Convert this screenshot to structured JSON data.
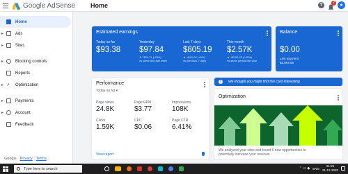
{
  "header": {
    "app_name": "Google AdSense",
    "page_title": "Home",
    "notification_count": "2"
  },
  "sidebar": {
    "items": [
      {
        "label": "Home",
        "expandable": false,
        "active": true
      },
      {
        "label": "Ads",
        "expandable": true
      },
      {
        "label": "Sites",
        "expandable": true
      },
      {
        "label": "Blocking controls",
        "expandable": true
      },
      {
        "label": "Reports",
        "expandable": false
      },
      {
        "label": "Optimization",
        "expandable": true
      },
      {
        "label": "Payments",
        "expandable": true
      },
      {
        "label": "Account",
        "expandable": true
      },
      {
        "label": "Feedback",
        "expandable": false
      }
    ],
    "footer": {
      "brand": "Google",
      "privacy": "Privacy",
      "terms": "Terms"
    }
  },
  "estimated": {
    "title": "Estimated earnings",
    "cols": [
      {
        "label": "Today so far",
        "value": "$93.38",
        "change": "",
        "sub": ""
      },
      {
        "label": "Yesterday",
        "value": "$97.84",
        "change": "▼ -$29.71 (-23%)",
        "sub": "vs same day last week"
      },
      {
        "label": "Last 7 days",
        "value": "$805.19",
        "change": "▲ +$41.02 (+5%)",
        "sub": "vs previous 7 days"
      },
      {
        "label": "This month",
        "value": "$2.57K",
        "change": "▲ +$792.33 (+45%)",
        "sub": "vs same period last year"
      }
    ]
  },
  "balance": {
    "title": "Balance",
    "value": "$0.00",
    "sub1": "Last payment",
    "sub2": "$2,894.05"
  },
  "performance": {
    "title": "Performance",
    "range": "Today so far",
    "metrics": [
      {
        "label": "Page views",
        "value": "24.8K"
      },
      {
        "label": "Page RPM",
        "value": "$3.77"
      },
      {
        "label": "Impressions",
        "value": "108K"
      },
      {
        "label": "Clicks",
        "value": "1.59K"
      },
      {
        "label": "CPC",
        "value": "$0.06"
      },
      {
        "label": "Page CTR",
        "value": "6.41%"
      }
    ],
    "view_report": "View report"
  },
  "banner": {
    "text": "We thought you might find this card interesting"
  },
  "optimization": {
    "title": "Optimization",
    "desc_line1": "We analyzed your sites and found 6 new opportunities to",
    "desc_line2": "potentially increase your revenue."
  },
  "taskbar": {
    "search_placeholder": "Type here to search",
    "lang": "ENG",
    "time": "21:25",
    "date": "21-12-2020"
  },
  "colors": {
    "accent": "#1967d2",
    "art_bg": "#0d652d"
  },
  "icons": [
    "menu-icon",
    "help-icon",
    "bell-icon",
    "avatar",
    "windows-icon",
    "search-icon"
  ]
}
